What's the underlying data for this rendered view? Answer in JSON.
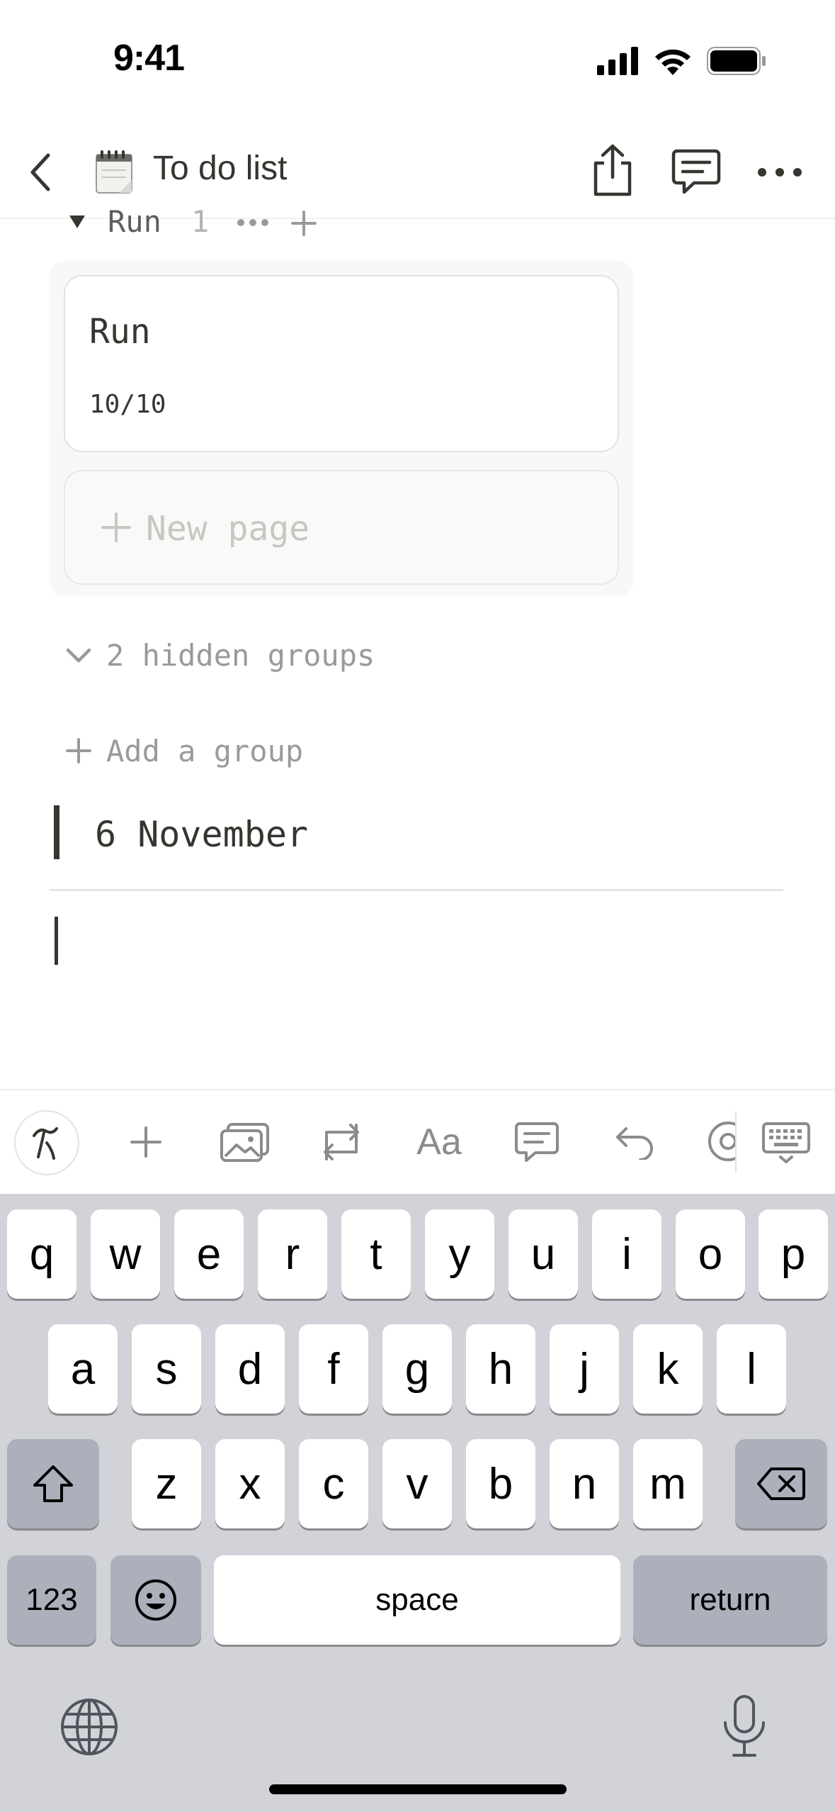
{
  "status_bar": {
    "time": "9:41"
  },
  "nav": {
    "title": "To do list",
    "page_icon": "notepad-icon"
  },
  "board": {
    "group_name": "Run",
    "group_count": "1",
    "card": {
      "title": "Run",
      "progress": "10/10"
    },
    "new_page_label": "New page",
    "hidden_groups_label": "2 hidden groups",
    "add_group_label": "Add a group"
  },
  "document": {
    "date_heading": "6 November"
  },
  "toolbar": {
    "text_style_label": "Aa",
    "icons": [
      "ai-assistant-icon",
      "plus-icon",
      "image-icon",
      "turn-into-icon",
      "text-style-icon",
      "comment-icon",
      "undo-icon",
      "mention-icon",
      "keyboard-dismiss-icon"
    ]
  },
  "keyboard": {
    "row1": [
      "q",
      "w",
      "e",
      "r",
      "t",
      "y",
      "u",
      "i",
      "o",
      "p"
    ],
    "row2": [
      "a",
      "s",
      "d",
      "f",
      "g",
      "h",
      "j",
      "k",
      "l"
    ],
    "row3": [
      "z",
      "x",
      "c",
      "v",
      "b",
      "n",
      "m"
    ],
    "numbers_label": "123",
    "space_label": "space",
    "return_label": "return"
  }
}
